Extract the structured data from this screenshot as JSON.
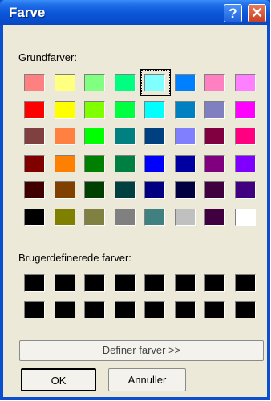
{
  "window": {
    "title": "Farve",
    "help_glyph": "?",
    "close_glyph": "✕"
  },
  "basic": {
    "label": "Grundfarver:",
    "rows": [
      [
        "#ff8080",
        "#ffff80",
        "#80ff80",
        "#00ff80",
        "#80ffff",
        "#0080ff",
        "#ff80c0",
        "#ff80ff"
      ],
      [
        "#ff0000",
        "#ffff00",
        "#80ff00",
        "#00ff40",
        "#00ffff",
        "#0080c0",
        "#8080c0",
        "#ff00ff"
      ],
      [
        "#804040",
        "#ff8040",
        "#00ff00",
        "#008080",
        "#004080",
        "#8080ff",
        "#800040",
        "#ff0080"
      ],
      [
        "#800000",
        "#ff8000",
        "#008000",
        "#008040",
        "#0000ff",
        "#0000a0",
        "#800080",
        "#8000ff"
      ],
      [
        "#400000",
        "#804000",
        "#004000",
        "#004040",
        "#000080",
        "#000040",
        "#400040",
        "#400080"
      ],
      [
        "#000000",
        "#808000",
        "#808040",
        "#808080",
        "#408080",
        "#c0c0c0",
        "#400040",
        "#ffffff"
      ]
    ],
    "selected": "row 1, column 5"
  },
  "custom": {
    "label": "Brugerdefinerede farver:",
    "rows": [
      [
        "#000000",
        "#000000",
        "#000000",
        "#000000",
        "#000000",
        "#000000",
        "#000000",
        "#000000"
      ],
      [
        "#000000",
        "#000000",
        "#000000",
        "#000000",
        "#000000",
        "#000000",
        "#000000",
        "#000000"
      ]
    ]
  },
  "buttons": {
    "define": "Definer farver >>",
    "ok": "OK",
    "cancel": "Annuller"
  }
}
